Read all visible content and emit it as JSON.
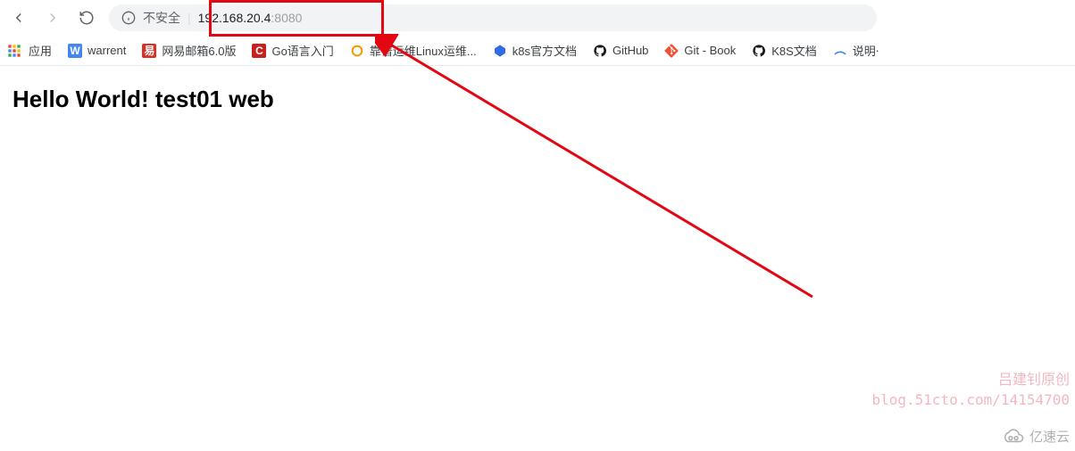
{
  "toolbar": {
    "not_secure_label": "不安全",
    "url_host": "192.168.20.4",
    "url_port": ":8080"
  },
  "bookmarks": {
    "apps_label": "应用",
    "items": [
      {
        "label": "warrent"
      },
      {
        "label": "网易邮箱6.0版"
      },
      {
        "label": "Go语言入门"
      },
      {
        "label": "靠谱运维Linux运维..."
      },
      {
        "label": "k8s官方文档"
      },
      {
        "label": "GitHub"
      },
      {
        "label": "Git - Book"
      },
      {
        "label": "K8S文档"
      },
      {
        "label": "说明ᐧ"
      }
    ]
  },
  "page": {
    "heading": "Hello World! test01 web"
  },
  "watermark": {
    "line1": "吕建钊原创",
    "line2": "blog.51cto.com/14154700"
  },
  "footer": {
    "brand": "亿速云"
  }
}
